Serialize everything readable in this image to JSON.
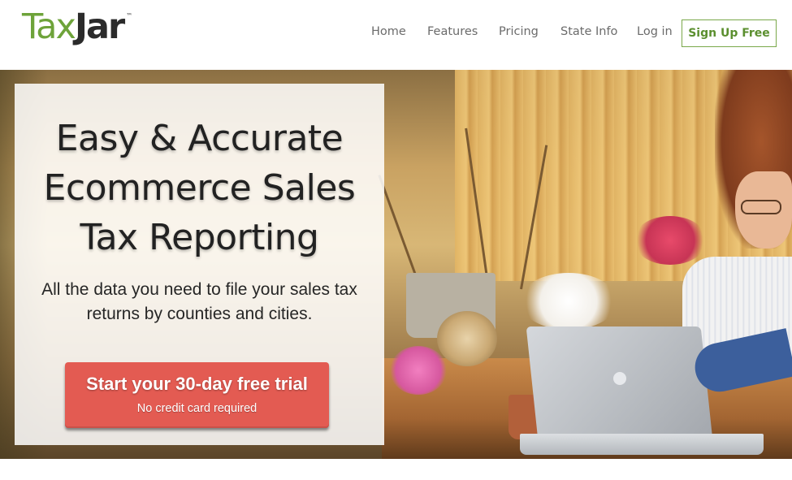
{
  "brand": {
    "logo_part1": "Tax",
    "logo_part2": "Jar",
    "trademark": "™",
    "green": "#6ea33a",
    "accent_red": "#e35b52"
  },
  "nav": {
    "items": [
      {
        "label": "Home"
      },
      {
        "label": "Features"
      },
      {
        "label": "Pricing"
      },
      {
        "label": "State Info"
      },
      {
        "label": "Log in"
      }
    ],
    "signup_label": "Sign Up Free"
  },
  "hero": {
    "headline_lines": [
      "Easy & Accurate",
      "Ecommerce Sales",
      "Tax Reporting"
    ],
    "subtext": "All the data you need to file your sales tax returns by counties and cities.",
    "cta_main": "Start your 30-day free trial",
    "cta_sub": "No credit card required"
  }
}
